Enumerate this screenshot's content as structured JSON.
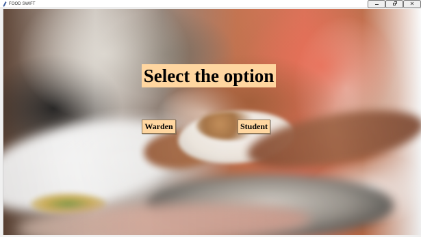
{
  "window": {
    "title": "FOOD SWIFT",
    "controls": {
      "minimize": "–",
      "maximize": "□",
      "close": "✕"
    }
  },
  "main": {
    "heading": "Select the option",
    "buttons": {
      "warden": "Warden",
      "student": "Student"
    }
  },
  "colors": {
    "label_background": "#ffd6a0",
    "button_background": "#ffd6a0",
    "text": "#000000"
  },
  "icons": {
    "app": "feather-icon",
    "minimize": "minimize-icon",
    "maximize": "maximize-icon",
    "close": "close-icon"
  }
}
